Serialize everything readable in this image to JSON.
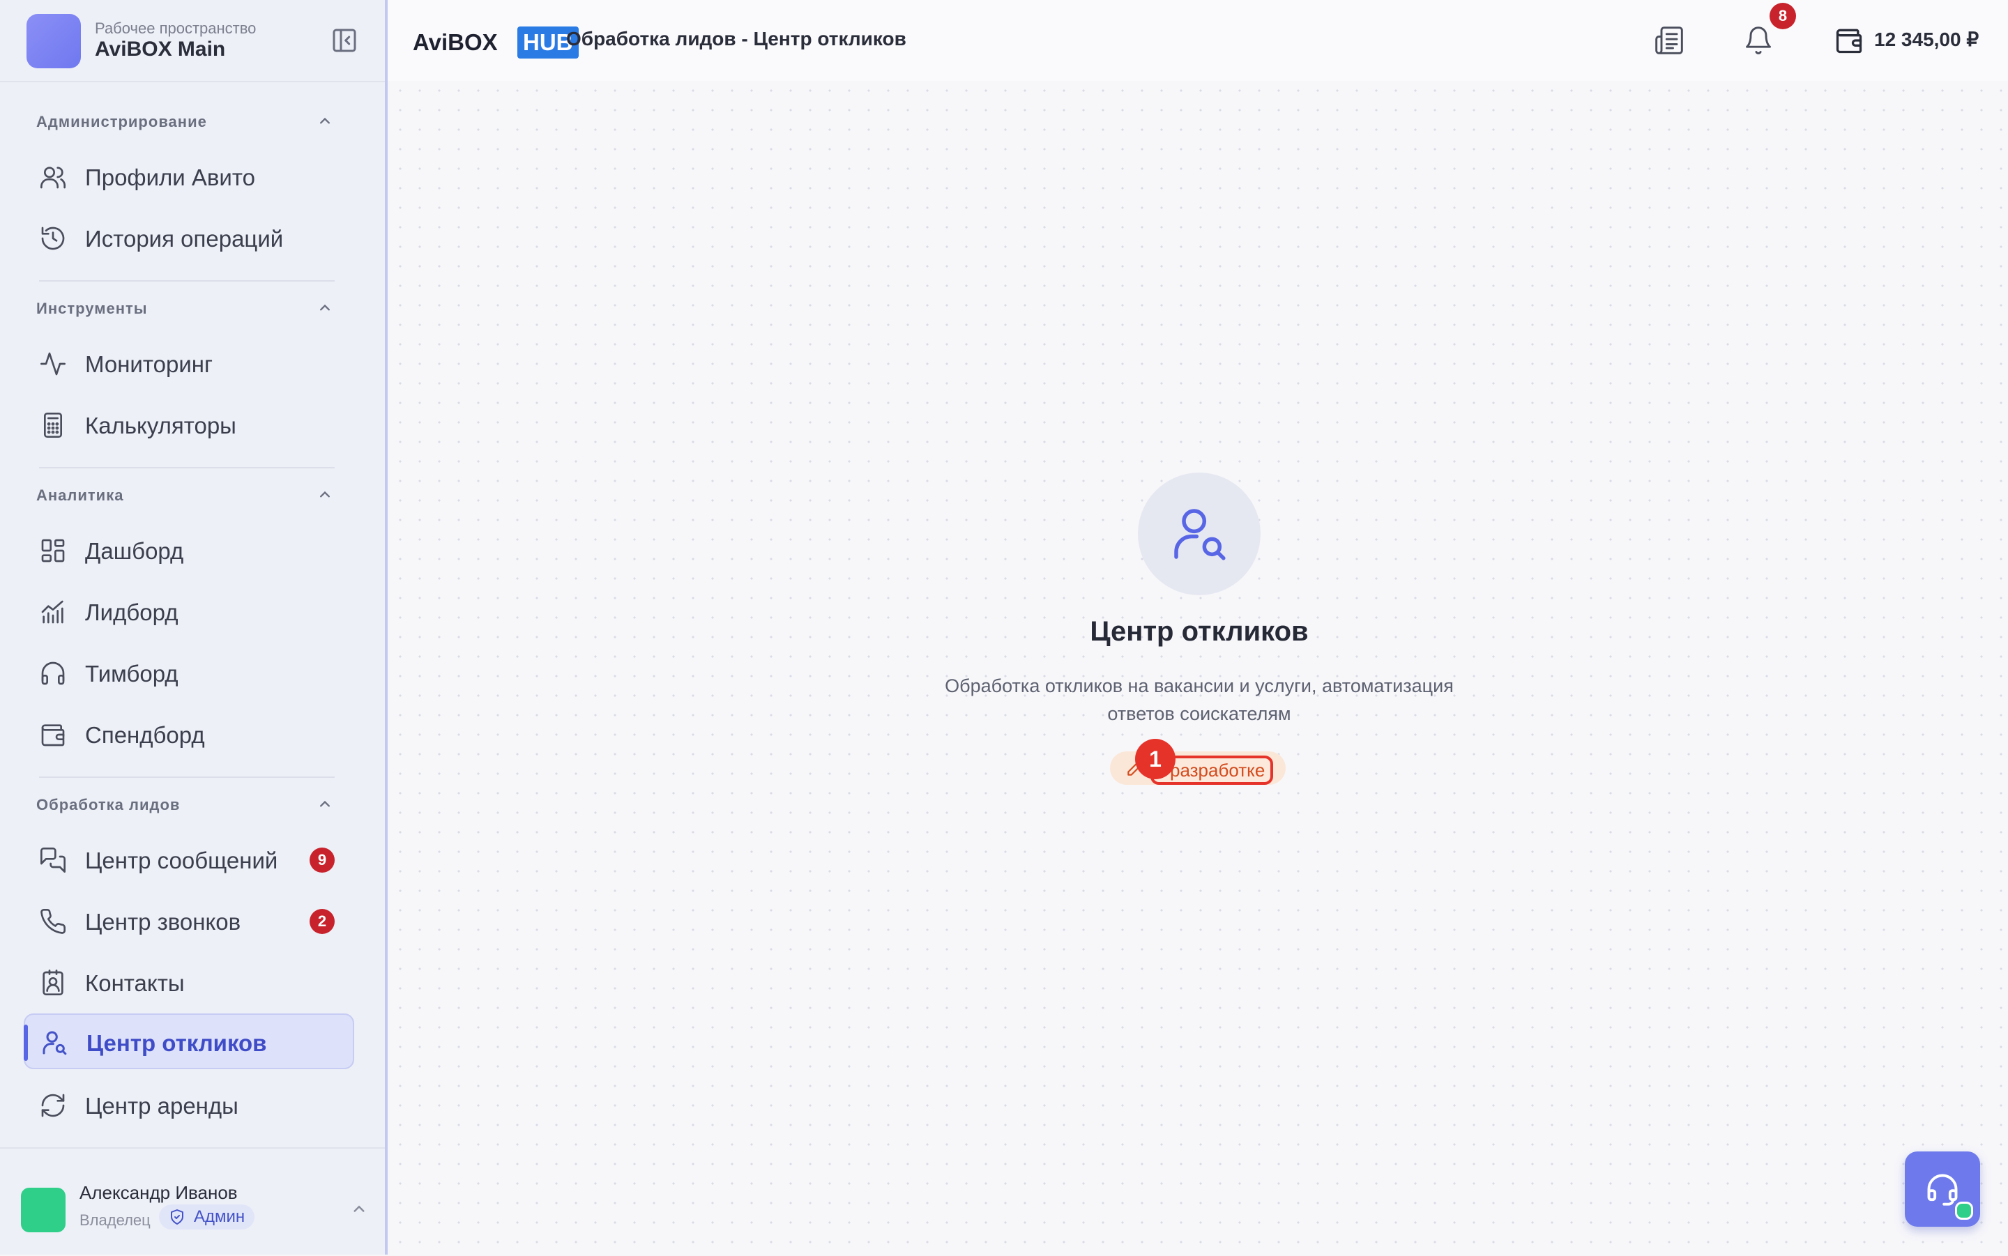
{
  "workspace": {
    "caption": "Рабочее пространство",
    "name": "AviBOX Main"
  },
  "sections": [
    {
      "title": "Администрирование",
      "items": [
        {
          "label": "Профили Авито",
          "icon": "users-icon"
        },
        {
          "label": "История операций",
          "icon": "history-icon"
        }
      ]
    },
    {
      "title": "Инструменты",
      "items": [
        {
          "label": "Мониторинг",
          "icon": "activity-icon"
        },
        {
          "label": "Калькуляторы",
          "icon": "calculator-icon"
        }
      ]
    },
    {
      "title": "Аналитика",
      "items": [
        {
          "label": "Дашборд",
          "icon": "dashboard-icon"
        },
        {
          "label": "Лидборд",
          "icon": "chart-icon"
        },
        {
          "label": "Тимборд",
          "icon": "headphones-icon"
        },
        {
          "label": "Спендборд",
          "icon": "wallet-icon"
        }
      ]
    },
    {
      "title": "Обработка лидов",
      "items": [
        {
          "label": "Центр сообщений",
          "icon": "messages-icon",
          "badge": "9"
        },
        {
          "label": "Центр звонков",
          "icon": "phone-icon",
          "badge": "2"
        },
        {
          "label": "Контакты",
          "icon": "contacts-icon"
        },
        {
          "label": "Центр откликов",
          "icon": "user-search-icon",
          "active": true
        },
        {
          "label": "Центр аренды",
          "icon": "refresh-icon"
        }
      ]
    }
  ],
  "user": {
    "name": "Александр Иванов",
    "role": "Владелец",
    "badge": "Админ"
  },
  "topbar": {
    "brand_left": "AviBOX",
    "brand_right": "HUB",
    "page_title": "Обработка лидов - Центр откликов",
    "notifications_count": "8",
    "balance": "12 345,00 ₽"
  },
  "hero": {
    "title": "Центр откликов",
    "description_line1": "Обработка откликов на вакансии и услуги, автоматизация",
    "description_line2": "ответов соискателям",
    "status": "разработке",
    "marker": "1"
  },
  "colors": {
    "accent": "#5866e6",
    "badge_red": "#c8232c",
    "brand_blue": "#2b7be5",
    "success": "#2fcf8a"
  }
}
